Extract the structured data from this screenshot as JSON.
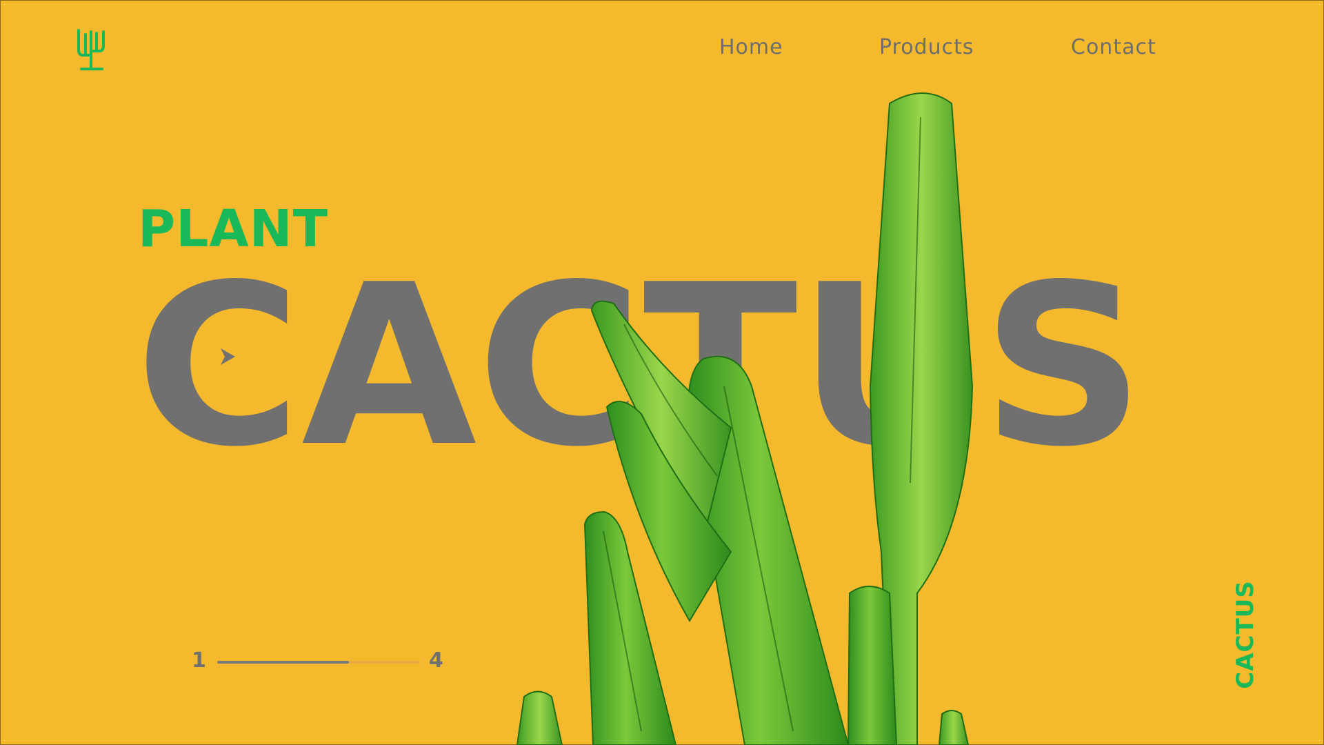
{
  "brand": {
    "logo_icon": "cactus-logo-icon",
    "color": "#19B95A"
  },
  "nav": {
    "items": [
      "Home",
      "Products",
      "Contact"
    ]
  },
  "hero": {
    "kicker": "PLANT",
    "title": "CACTUS",
    "play_icon": "play-icon"
  },
  "pager": {
    "start": "1",
    "end": "4",
    "progress": 0.65
  },
  "side_label": "CACTUS",
  "colors": {
    "background": "#F4B92C",
    "accent": "#19B95A",
    "title": "#707070",
    "plant": "#3DA22A"
  }
}
